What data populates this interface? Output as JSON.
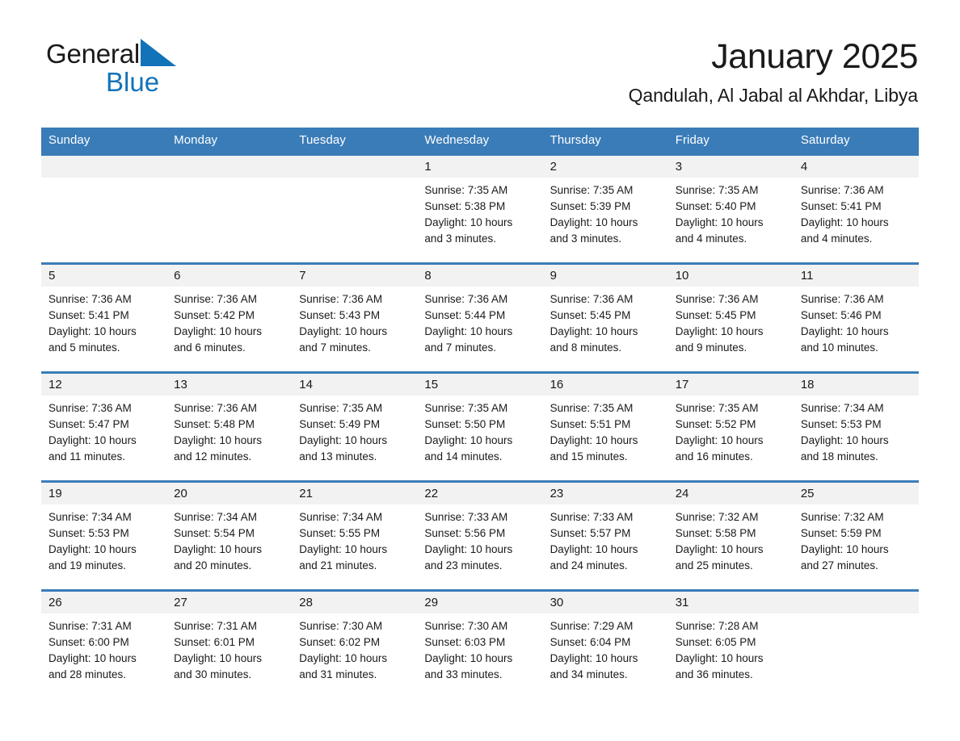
{
  "brand": {
    "name_part1": "General",
    "name_part2": "Blue",
    "accent_color": "#1273b8"
  },
  "header": {
    "title": "January 2025",
    "subtitle": "Qandulah, Al Jabal al Akhdar, Libya"
  },
  "theme": {
    "header_blue": "#3a7cb8",
    "date_band_gray": "#f2f2f2",
    "text_color": "#1a1a1a"
  },
  "weekday_headers": [
    "Sunday",
    "Monday",
    "Tuesday",
    "Wednesday",
    "Thursday",
    "Friday",
    "Saturday"
  ],
  "weeks": [
    [
      {
        "day": "",
        "sunrise": "",
        "sunset": "",
        "daylight_line1": "",
        "daylight_line2": ""
      },
      {
        "day": "",
        "sunrise": "",
        "sunset": "",
        "daylight_line1": "",
        "daylight_line2": ""
      },
      {
        "day": "",
        "sunrise": "",
        "sunset": "",
        "daylight_line1": "",
        "daylight_line2": ""
      },
      {
        "day": "1",
        "sunrise": "Sunrise: 7:35 AM",
        "sunset": "Sunset: 5:38 PM",
        "daylight_line1": "Daylight: 10 hours",
        "daylight_line2": "and 3 minutes."
      },
      {
        "day": "2",
        "sunrise": "Sunrise: 7:35 AM",
        "sunset": "Sunset: 5:39 PM",
        "daylight_line1": "Daylight: 10 hours",
        "daylight_line2": "and 3 minutes."
      },
      {
        "day": "3",
        "sunrise": "Sunrise: 7:35 AM",
        "sunset": "Sunset: 5:40 PM",
        "daylight_line1": "Daylight: 10 hours",
        "daylight_line2": "and 4 minutes."
      },
      {
        "day": "4",
        "sunrise": "Sunrise: 7:36 AM",
        "sunset": "Sunset: 5:41 PM",
        "daylight_line1": "Daylight: 10 hours",
        "daylight_line2": "and 4 minutes."
      }
    ],
    [
      {
        "day": "5",
        "sunrise": "Sunrise: 7:36 AM",
        "sunset": "Sunset: 5:41 PM",
        "daylight_line1": "Daylight: 10 hours",
        "daylight_line2": "and 5 minutes."
      },
      {
        "day": "6",
        "sunrise": "Sunrise: 7:36 AM",
        "sunset": "Sunset: 5:42 PM",
        "daylight_line1": "Daylight: 10 hours",
        "daylight_line2": "and 6 minutes."
      },
      {
        "day": "7",
        "sunrise": "Sunrise: 7:36 AM",
        "sunset": "Sunset: 5:43 PM",
        "daylight_line1": "Daylight: 10 hours",
        "daylight_line2": "and 7 minutes."
      },
      {
        "day": "8",
        "sunrise": "Sunrise: 7:36 AM",
        "sunset": "Sunset: 5:44 PM",
        "daylight_line1": "Daylight: 10 hours",
        "daylight_line2": "and 7 minutes."
      },
      {
        "day": "9",
        "sunrise": "Sunrise: 7:36 AM",
        "sunset": "Sunset: 5:45 PM",
        "daylight_line1": "Daylight: 10 hours",
        "daylight_line2": "and 8 minutes."
      },
      {
        "day": "10",
        "sunrise": "Sunrise: 7:36 AM",
        "sunset": "Sunset: 5:45 PM",
        "daylight_line1": "Daylight: 10 hours",
        "daylight_line2": "and 9 minutes."
      },
      {
        "day": "11",
        "sunrise": "Sunrise: 7:36 AM",
        "sunset": "Sunset: 5:46 PM",
        "daylight_line1": "Daylight: 10 hours",
        "daylight_line2": "and 10 minutes."
      }
    ],
    [
      {
        "day": "12",
        "sunrise": "Sunrise: 7:36 AM",
        "sunset": "Sunset: 5:47 PM",
        "daylight_line1": "Daylight: 10 hours",
        "daylight_line2": "and 11 minutes."
      },
      {
        "day": "13",
        "sunrise": "Sunrise: 7:36 AM",
        "sunset": "Sunset: 5:48 PM",
        "daylight_line1": "Daylight: 10 hours",
        "daylight_line2": "and 12 minutes."
      },
      {
        "day": "14",
        "sunrise": "Sunrise: 7:35 AM",
        "sunset": "Sunset: 5:49 PM",
        "daylight_line1": "Daylight: 10 hours",
        "daylight_line2": "and 13 minutes."
      },
      {
        "day": "15",
        "sunrise": "Sunrise: 7:35 AM",
        "sunset": "Sunset: 5:50 PM",
        "daylight_line1": "Daylight: 10 hours",
        "daylight_line2": "and 14 minutes."
      },
      {
        "day": "16",
        "sunrise": "Sunrise: 7:35 AM",
        "sunset": "Sunset: 5:51 PM",
        "daylight_line1": "Daylight: 10 hours",
        "daylight_line2": "and 15 minutes."
      },
      {
        "day": "17",
        "sunrise": "Sunrise: 7:35 AM",
        "sunset": "Sunset: 5:52 PM",
        "daylight_line1": "Daylight: 10 hours",
        "daylight_line2": "and 16 minutes."
      },
      {
        "day": "18",
        "sunrise": "Sunrise: 7:34 AM",
        "sunset": "Sunset: 5:53 PM",
        "daylight_line1": "Daylight: 10 hours",
        "daylight_line2": "and 18 minutes."
      }
    ],
    [
      {
        "day": "19",
        "sunrise": "Sunrise: 7:34 AM",
        "sunset": "Sunset: 5:53 PM",
        "daylight_line1": "Daylight: 10 hours",
        "daylight_line2": "and 19 minutes."
      },
      {
        "day": "20",
        "sunrise": "Sunrise: 7:34 AM",
        "sunset": "Sunset: 5:54 PM",
        "daylight_line1": "Daylight: 10 hours",
        "daylight_line2": "and 20 minutes."
      },
      {
        "day": "21",
        "sunrise": "Sunrise: 7:34 AM",
        "sunset": "Sunset: 5:55 PM",
        "daylight_line1": "Daylight: 10 hours",
        "daylight_line2": "and 21 minutes."
      },
      {
        "day": "22",
        "sunrise": "Sunrise: 7:33 AM",
        "sunset": "Sunset: 5:56 PM",
        "daylight_line1": "Daylight: 10 hours",
        "daylight_line2": "and 23 minutes."
      },
      {
        "day": "23",
        "sunrise": "Sunrise: 7:33 AM",
        "sunset": "Sunset: 5:57 PM",
        "daylight_line1": "Daylight: 10 hours",
        "daylight_line2": "and 24 minutes."
      },
      {
        "day": "24",
        "sunrise": "Sunrise: 7:32 AM",
        "sunset": "Sunset: 5:58 PM",
        "daylight_line1": "Daylight: 10 hours",
        "daylight_line2": "and 25 minutes."
      },
      {
        "day": "25",
        "sunrise": "Sunrise: 7:32 AM",
        "sunset": "Sunset: 5:59 PM",
        "daylight_line1": "Daylight: 10 hours",
        "daylight_line2": "and 27 minutes."
      }
    ],
    [
      {
        "day": "26",
        "sunrise": "Sunrise: 7:31 AM",
        "sunset": "Sunset: 6:00 PM",
        "daylight_line1": "Daylight: 10 hours",
        "daylight_line2": "and 28 minutes."
      },
      {
        "day": "27",
        "sunrise": "Sunrise: 7:31 AM",
        "sunset": "Sunset: 6:01 PM",
        "daylight_line1": "Daylight: 10 hours",
        "daylight_line2": "and 30 minutes."
      },
      {
        "day": "28",
        "sunrise": "Sunrise: 7:30 AM",
        "sunset": "Sunset: 6:02 PM",
        "daylight_line1": "Daylight: 10 hours",
        "daylight_line2": "and 31 minutes."
      },
      {
        "day": "29",
        "sunrise": "Sunrise: 7:30 AM",
        "sunset": "Sunset: 6:03 PM",
        "daylight_line1": "Daylight: 10 hours",
        "daylight_line2": "and 33 minutes."
      },
      {
        "day": "30",
        "sunrise": "Sunrise: 7:29 AM",
        "sunset": "Sunset: 6:04 PM",
        "daylight_line1": "Daylight: 10 hours",
        "daylight_line2": "and 34 minutes."
      },
      {
        "day": "31",
        "sunrise": "Sunrise: 7:28 AM",
        "sunset": "Sunset: 6:05 PM",
        "daylight_line1": "Daylight: 10 hours",
        "daylight_line2": "and 36 minutes."
      },
      {
        "day": "",
        "sunrise": "",
        "sunset": "",
        "daylight_line1": "",
        "daylight_line2": ""
      }
    ]
  ]
}
